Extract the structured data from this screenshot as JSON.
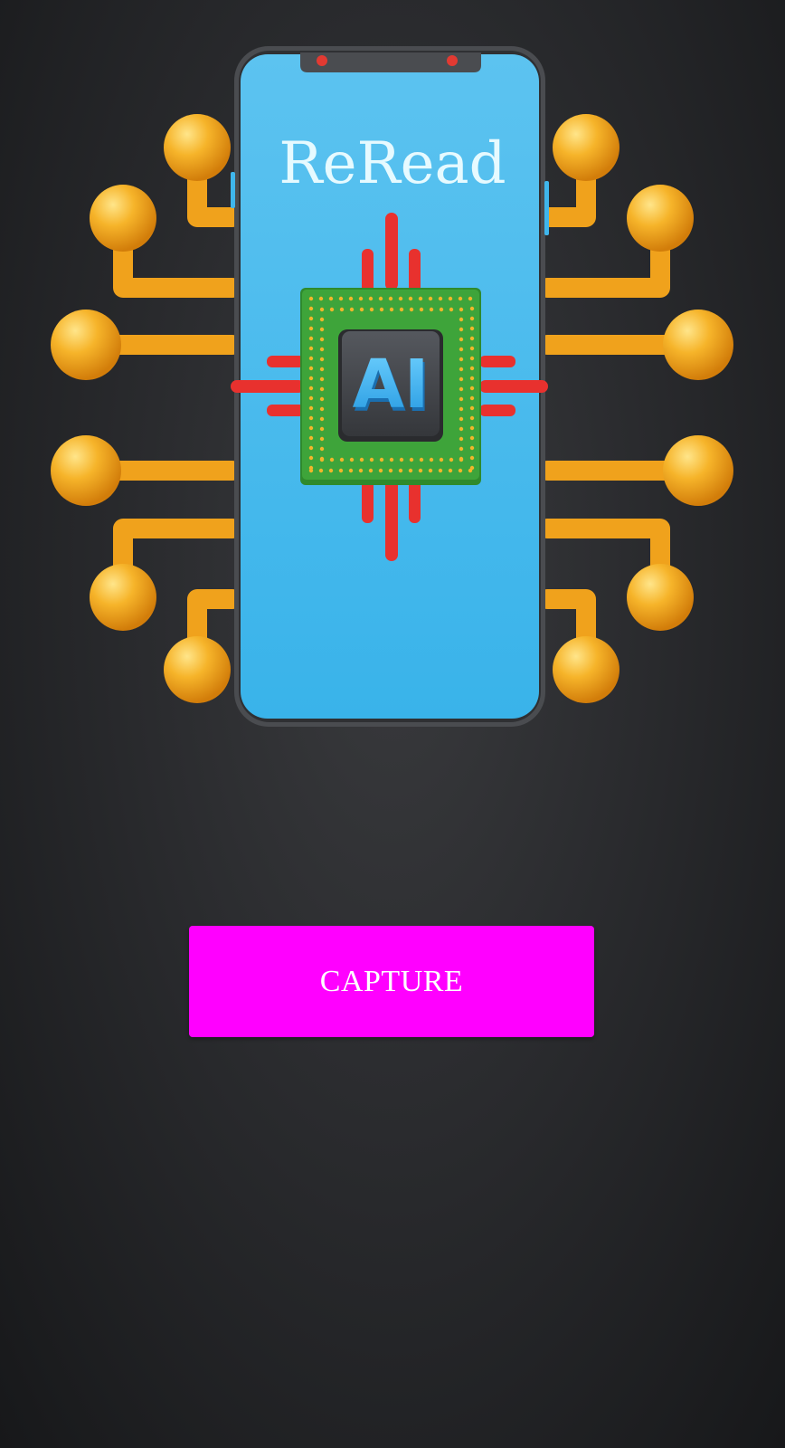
{
  "app": {
    "title": "ReRead"
  },
  "hero": {
    "illustration": "phone-with-ai-chip",
    "chip_label": "AI"
  },
  "actions": {
    "capture_label": "CAPTURE"
  },
  "colors": {
    "background": "#2a2b2e",
    "phone_screen": "#3fb6ec",
    "capture_button": "#ff00ff",
    "capture_text": "#ffffff",
    "circuit_gold": "#f4a51c",
    "chip_board": "#3ea43a",
    "chip_pins": "#e8312e"
  }
}
